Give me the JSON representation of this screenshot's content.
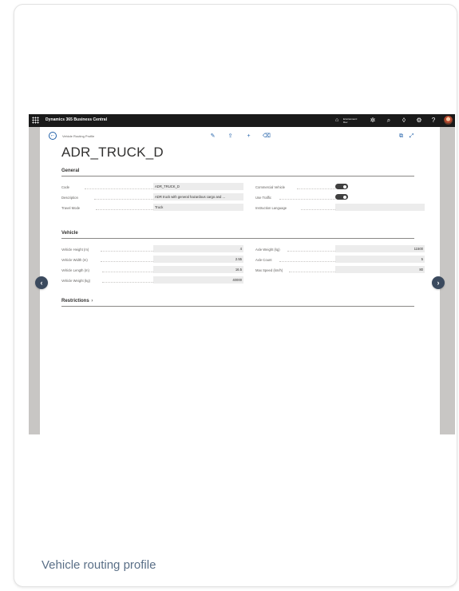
{
  "caption": "Vehicle routing profile",
  "topbar": {
    "app_name": "Dynamics 365 Business Central",
    "environment_line1": "Environment:",
    "environment_line2": "Dev",
    "icons": [
      "waffle-icon",
      "building-icon",
      "copilot-icon",
      "search-icon",
      "bell-icon",
      "gear-icon",
      "help-icon",
      "avatar"
    ]
  },
  "page": {
    "breadcrumb": "Vehicle Routing Profile",
    "title": "ADR_TRUCK_D",
    "actions": [
      "edit-icon",
      "share-icon",
      "new-icon",
      "delete-icon"
    ],
    "right_actions": [
      "open-new-window-icon",
      "expand-icon"
    ]
  },
  "general": {
    "heading": "General",
    "code_label": "Code",
    "code_value": "ADR_TRUCK_D",
    "description_label": "Description",
    "description_value": "ADR truck with general hazardous cargo and ...",
    "travel_mode_label": "Travel Mode",
    "travel_mode_value": "Truck",
    "commercial_vehicle_label": "Commercial Vehicle",
    "commercial_vehicle_on": true,
    "use_traffic_label": "Use Traffic",
    "use_traffic_on": true,
    "instruction_language_label": "Instruction Language",
    "instruction_language_value": ""
  },
  "vehicle": {
    "heading": "Vehicle",
    "height_label": "Vehicle Height (m)",
    "height_value": "4",
    "width_label": "Vehicle Width (m)",
    "width_value": "2.55",
    "length_label": "Vehicle Length (m)",
    "length_value": "16.5",
    "weight_label": "Vehicle Weight (kg)",
    "weight_value": "40000",
    "axle_weight_label": "Axle Weight (kg)",
    "axle_weight_value": "11500",
    "axle_count_label": "Axle Count",
    "axle_count_value": "5",
    "max_speed_label": "Max Speed (km/h)",
    "max_speed_value": "80"
  },
  "restrictions": {
    "heading": "Restrictions",
    "chevron": "›"
  },
  "colors": {
    "topbar": "#1a1a1a",
    "accent": "#1f5fa8",
    "nav_arrow": "#3b4a5e",
    "caption": "#5a6f87"
  }
}
